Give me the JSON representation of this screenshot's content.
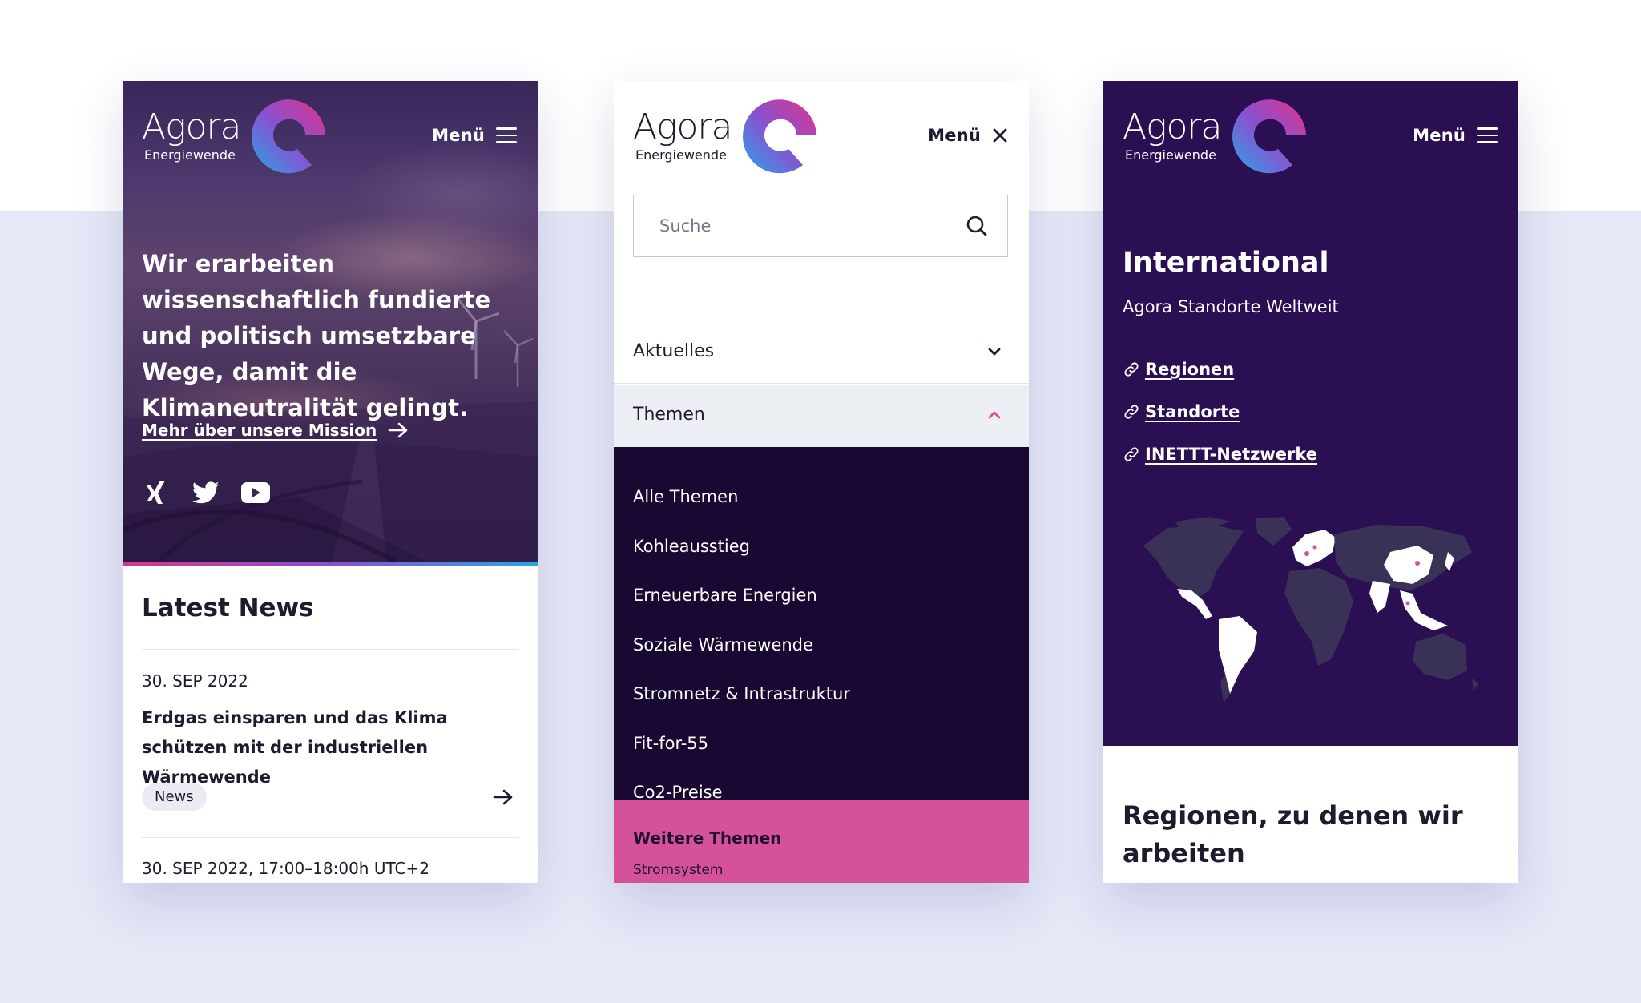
{
  "logo": {
    "word": "Agora",
    "sub": "Energiewende"
  },
  "menu_label": "Menü",
  "phone1": {
    "hero_title": "Wir erarbeiten wissenschaftlich fundierte und politisch umsetzbare Wege, damit die Klimaneutralität gelingt.",
    "mission_link": "Mehr über unsere Mission",
    "social_icons": [
      "xing-icon",
      "twitter-icon",
      "youtube-icon"
    ],
    "news_heading": "Latest News",
    "news": [
      {
        "date": "30. SEP 2022",
        "title": "Erdgas einsparen und das Klima schützen mit der industriellen Wärmewende",
        "tag": "News"
      },
      {
        "date": "30. SEP 2022, 17:00–18:00h UTC+2"
      }
    ]
  },
  "phone2": {
    "search_placeholder": "Suche",
    "accordion": [
      {
        "label": "Aktuelles",
        "state": "collapsed"
      },
      {
        "label": "Themen",
        "state": "expanded"
      }
    ],
    "themen_items": [
      "Alle Themen",
      "Kohleausstieg",
      "Erneuerbare Energien",
      "Soziale Wärmewende",
      "Stromnetz & Intrastruktur",
      "Fit-for-55",
      "Co2-Preise"
    ],
    "weitere_title": "Weitere Themen",
    "weitere_items": [
      "Stromsystem"
    ]
  },
  "phone3": {
    "title": "International",
    "subtitle": "Agora Standorte Weltweit",
    "links": [
      "Regionen",
      "Standorte",
      "INETTT-Netzwerke"
    ],
    "regions_title": "Regionen, zu denen wir arbeiten"
  },
  "colors": {
    "page_bg": "#e6e8f8",
    "deep_purple": "#2a0f52",
    "menu_dark": "#190932",
    "pink": "#d5529a",
    "accent_gradient": [
      "#d2378d",
      "#2aa5e6"
    ]
  }
}
